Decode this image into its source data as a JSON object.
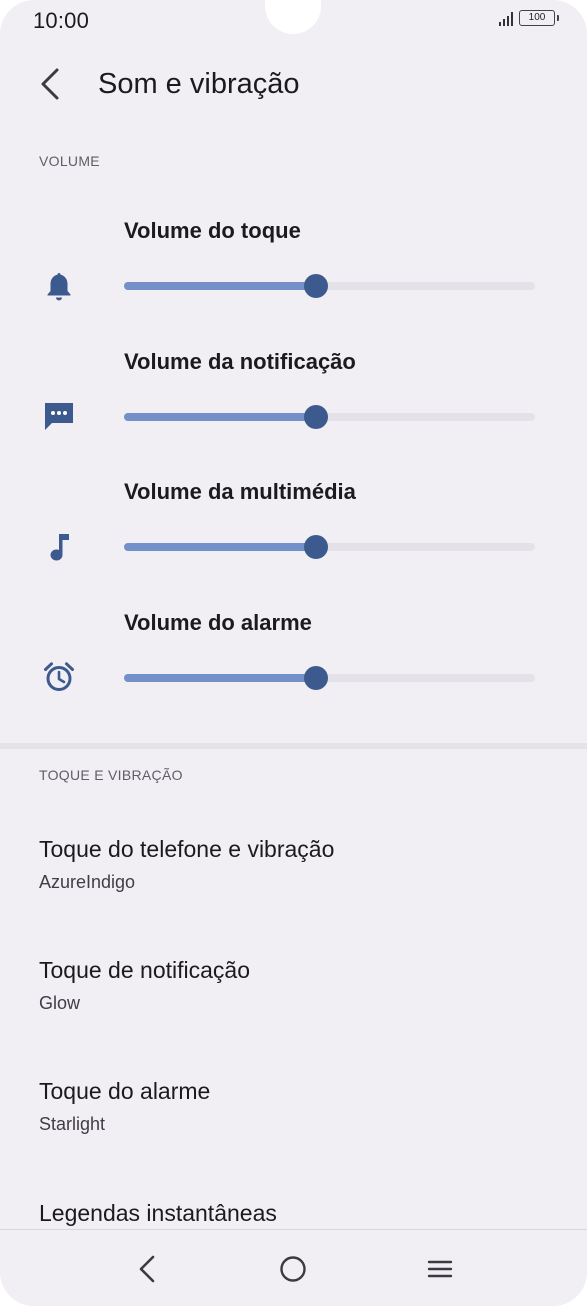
{
  "status_bar": {
    "time": "10:00",
    "battery": "100"
  },
  "header": {
    "title": "Som e vibração"
  },
  "volume_section": {
    "header": "VOLUME",
    "sliders": [
      {
        "label": "Volume do toque",
        "icon": "bell-icon",
        "level": 0.468
      },
      {
        "label": "Volume da notificação",
        "icon": "message-icon",
        "level": 0.468
      },
      {
        "label": "Volume da multimédia",
        "icon": "music-note-icon",
        "level": 0.468
      },
      {
        "label": "Volume do alarme",
        "icon": "alarm-clock-icon",
        "level": 0.468
      }
    ]
  },
  "ringtone_section": {
    "header": "TOQUE E VIBRAÇÃO",
    "items": [
      {
        "title": "Toque do telefone e vibração",
        "subtitle": "AzureIndigo"
      },
      {
        "title": "Toque de notificação",
        "subtitle": "Glow"
      },
      {
        "title": "Toque do alarme",
        "subtitle": "Starlight"
      },
      {
        "title": "Legendas instantâneas",
        "subtitle": ""
      }
    ]
  },
  "colors": {
    "accent": "#3d5a8f",
    "slider_fill": "#7490c9",
    "slider_track": "#e4e2e8",
    "background": "#f1eff3"
  }
}
